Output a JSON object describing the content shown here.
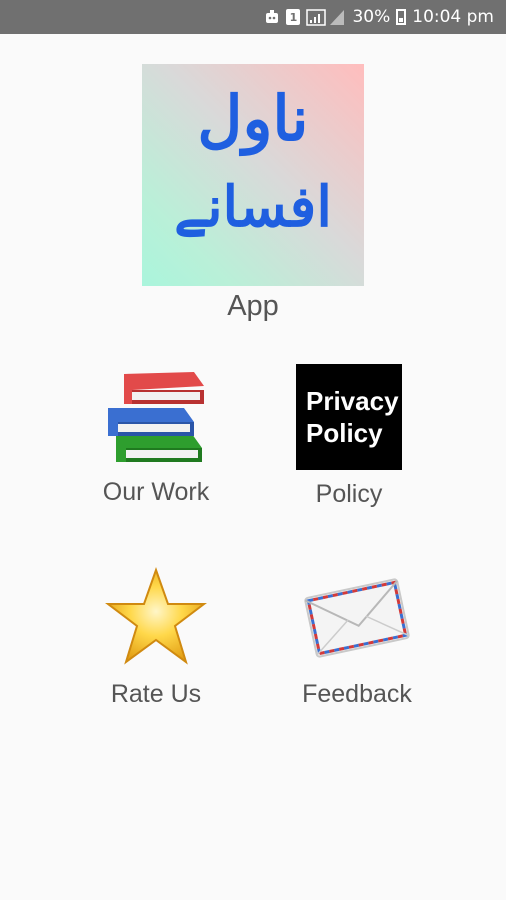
{
  "status_bar": {
    "sim": "1",
    "battery": "30%",
    "time": "10:04 pm"
  },
  "hero": {
    "line1": "ناول",
    "line2": "افسانے"
  },
  "app_label": "App",
  "tiles": [
    {
      "label": "Our Work",
      "icon": "books-icon"
    },
    {
      "label": "Policy",
      "icon": "privacy-policy-icon",
      "icon_text": [
        "Privacy",
        "Policy"
      ]
    },
    {
      "label": "Rate Us",
      "icon": "star-icon"
    },
    {
      "label": "Feedback",
      "icon": "envelope-icon"
    }
  ],
  "colors": {
    "status_bar": "#707070",
    "background": "#fafafa",
    "hero_text": "#1f5fe0",
    "label": "#555555"
  }
}
